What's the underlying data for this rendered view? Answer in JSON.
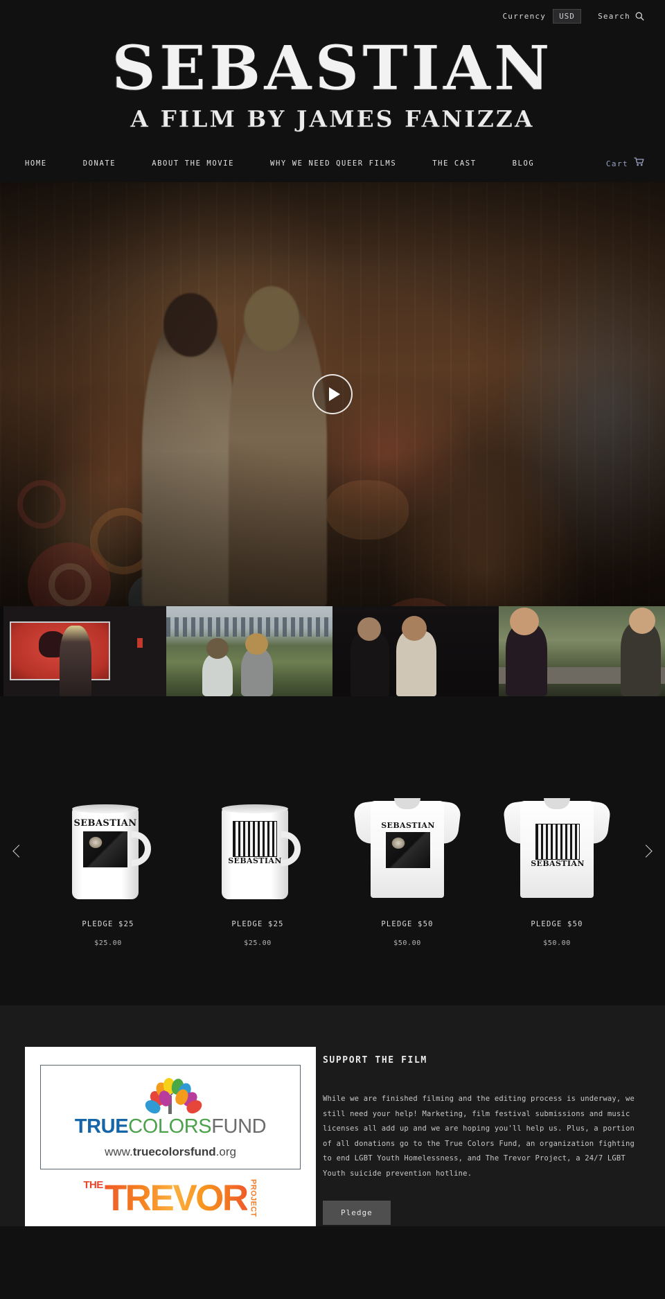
{
  "topbar": {
    "currency_label": "Currency",
    "currency_value": "USD",
    "currency_options": [
      "USD"
    ],
    "search_label": "Search",
    "search_icon": "search-icon"
  },
  "masthead": {
    "title": "SEBASTIAN",
    "subtitle": "A FILM BY JAMES FANIZZA"
  },
  "nav": {
    "items": [
      {
        "label": "HOME"
      },
      {
        "label": "DONATE"
      },
      {
        "label": "ABOUT THE MOVIE"
      },
      {
        "label": "WHY WE NEED QUEER FILMS"
      },
      {
        "label": "THE CAST"
      },
      {
        "label": "BLOG"
      }
    ],
    "cart_label": "Cart",
    "cart_icon": "shopping-cart-icon",
    "cart_color": "#9aa0c4"
  },
  "hero": {
    "play_icon": "play-icon",
    "caption": "Two men embracing in front of a graffiti wall"
  },
  "thumbnails": [
    {
      "caption": "Woman dancing in front of red projection screen"
    },
    {
      "caption": "Two people seated on grass with city skyline"
    },
    {
      "caption": "Two men smiling in a dark room"
    },
    {
      "caption": "Woman and man talking beside a road"
    }
  ],
  "carousel": {
    "prev_icon": "chevron-left-icon",
    "next_icon": "chevron-right-icon",
    "products": [
      {
        "title": "PLEDGE $25",
        "price": "$25.00",
        "type": "mug"
      },
      {
        "title": "PLEDGE $25",
        "price": "$25.00",
        "type": "mug"
      },
      {
        "title": "PLEDGE $50",
        "price": "$50.00",
        "type": "tshirt"
      },
      {
        "title": "PLEDGE $50",
        "price": "$50.00",
        "type": "tshirt"
      }
    ],
    "art_word": "SEBASTIAN"
  },
  "support": {
    "heading": "SUPPORT THE FILM",
    "body": "While we are finished filming and the editing process is underway, we still need your help! Marketing, film festival submissions and music licenses all add up and we are hoping you'll help us. Plus, a portion of all donations go to the True Colors Fund, an organization fighting to end LGBT Youth Homelessness, and The Trevor Project, a 24/7 LGBT Youth suicide prevention hotline.",
    "pledge_label": "Pledge",
    "logos": {
      "true_colors": {
        "word_true": "TRUE",
        "word_colors": "COLORS",
        "word_fund": "FUND",
        "url_prefix": "www.",
        "url_main": "truecolorsfund",
        "url_suffix": ".org",
        "color_true": "#1565a8",
        "color_colors": "#4ba24b",
        "color_fund": "#6c6c6c"
      },
      "trevor": {
        "the": "THE",
        "main": "TREVOR",
        "project": "PROJECT",
        "color": "#f07f2d"
      }
    }
  },
  "colors": {
    "page_bg": "#111112",
    "support_bg": "#1b1b1c",
    "text": "#e3e3e3"
  }
}
